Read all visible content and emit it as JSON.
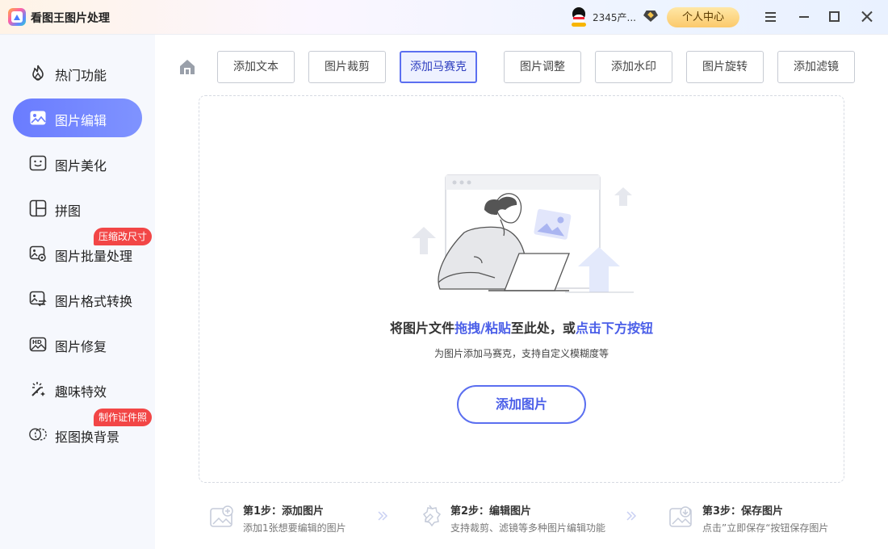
{
  "app": {
    "title": "看图王图片处理",
    "username": "2345产...",
    "user_center": "个人中心"
  },
  "icons": {
    "logo": "app-logo-icon",
    "avatar": "qq-penguin-icon",
    "vip": "vip-diamond-icon",
    "menu": "menu-icon",
    "minimize": "minimize-icon",
    "maximize": "maximize-icon",
    "close": "close-icon",
    "home": "home-icon"
  },
  "sidebar": {
    "items": [
      {
        "label": "热门功能",
        "icon": "flame-icon"
      },
      {
        "label": "图片编辑",
        "icon": "image-edit-icon",
        "active": true
      },
      {
        "label": "图片美化",
        "icon": "image-beautify-icon"
      },
      {
        "label": "拼图",
        "icon": "collage-icon"
      },
      {
        "label": "图片批量处理",
        "icon": "batch-image-icon",
        "badge": "压缩改尺寸"
      },
      {
        "label": "图片格式转换",
        "icon": "format-convert-icon"
      },
      {
        "label": "图片修复",
        "icon": "hd-repair-icon"
      },
      {
        "label": "趣味特效",
        "icon": "magic-wand-icon"
      },
      {
        "label": "抠图换背景",
        "icon": "cutout-icon",
        "badge": "制作证件照"
      }
    ]
  },
  "toolbar": {
    "buttons": [
      {
        "label": "添加文本"
      },
      {
        "label": "图片裁剪"
      },
      {
        "label": "添加马赛克",
        "active": true
      },
      {
        "label": "图片调整"
      },
      {
        "label": "添加水印"
      },
      {
        "label": "图片旋转"
      },
      {
        "label": "添加滤镜"
      }
    ]
  },
  "dropzone": {
    "text_pre": "将图片文件",
    "text_hl1": "拖拽/粘贴",
    "text_mid": "至此处，或",
    "text_hl2": "点击下方按钮",
    "subtitle": "为图片添加马赛克，支持自定义模糊度等",
    "add_button": "添加图片"
  },
  "steps": [
    {
      "title": "第1步：添加图片",
      "desc": "添加1张想要编辑的图片"
    },
    {
      "title": "第2步：编辑图片",
      "desc": "支持裁剪、滤镜等多种图片编辑功能"
    },
    {
      "title": "第3步：保存图片",
      "desc": "点击”立即保存“按钮保存图片"
    }
  ],
  "colors": {
    "accent": "#5b6ff0",
    "badge": "#f24646",
    "sidebar_bg": "#f6f8fd"
  }
}
